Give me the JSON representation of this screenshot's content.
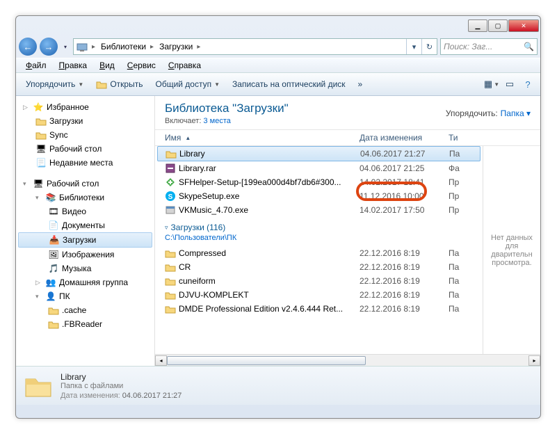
{
  "titlebar": {
    "min": "▁",
    "max": "▢",
    "close": "✕"
  },
  "nav": {
    "back": "←",
    "forward": "→",
    "dd": "▾",
    "refresh": "↻"
  },
  "breadcrumbs": [
    "Библиотеки",
    "Загрузки"
  ],
  "search": {
    "placeholder": "Поиск: Заг...",
    "icon": "🔍"
  },
  "menu": [
    {
      "label": "Файл",
      "u": "Ф"
    },
    {
      "label": "Правка",
      "u": "П"
    },
    {
      "label": "Вид",
      "u": "В"
    },
    {
      "label": "Сервис",
      "u": "С"
    },
    {
      "label": "Справка",
      "u": "С"
    }
  ],
  "toolbar": {
    "organize": "Упорядочить",
    "open": "Открыть",
    "share": "Общий доступ",
    "burn": "Записать на оптический диск",
    "more": "»"
  },
  "sidebar": {
    "favorites": {
      "label": "Избранное",
      "items": [
        {
          "label": "Загрузки",
          "ic": "folder"
        },
        {
          "label": "Sync",
          "ic": "folder"
        },
        {
          "label": "Рабочий стол",
          "ic": "desktop"
        },
        {
          "label": "Недавние места",
          "ic": "recent"
        }
      ]
    },
    "desktop": {
      "label": "Рабочий стол",
      "items": [
        {
          "label": "Библиотеки",
          "ic": "lib",
          "children": [
            {
              "label": "Видео",
              "ic": "video"
            },
            {
              "label": "Документы",
              "ic": "doc"
            },
            {
              "label": "Загрузки",
              "ic": "dl",
              "selected": true
            },
            {
              "label": "Изображения",
              "ic": "img"
            },
            {
              "label": "Музыка",
              "ic": "music"
            }
          ]
        },
        {
          "label": "Домашняя группа",
          "ic": "home"
        },
        {
          "label": "ПК",
          "ic": "pc",
          "children": [
            {
              "label": ".cache",
              "ic": "folder"
            },
            {
              "label": ".FBReader",
              "ic": "folder"
            }
          ]
        }
      ]
    }
  },
  "library": {
    "title": "Библиотека \"Загрузки\"",
    "includes_label": "Включает:",
    "includes_link": "3 места",
    "arrange_label": "Упорядочить:",
    "arrange_value": "Папка"
  },
  "columns": {
    "name": "Имя",
    "date": "Дата изменения",
    "type": "Ти"
  },
  "files_top": [
    {
      "name": "Library",
      "date": "04.06.2017 21:27",
      "type": "Па",
      "ic": "folder",
      "selected": true
    },
    {
      "name": "Library.rar",
      "date": "04.06.2017 21:25",
      "type": "Фа",
      "ic": "rar"
    },
    {
      "name": "SFHelper-Setup-[199ea000d4bf7db6#300...",
      "date": "14.02.2017 18:41",
      "type": "Пр",
      "ic": "exe-g"
    },
    {
      "name": "SkypeSetup.exe",
      "date": "11.12.2016 10:00",
      "type": "Пр",
      "ic": "skype"
    },
    {
      "name": "VKMusic_4.70.exe",
      "date": "14.02.2017 17:50",
      "type": "Пр",
      "ic": "exe"
    }
  ],
  "group": {
    "title": "Загрузки (116)",
    "path": "C:\\Пользователи\\ПК"
  },
  "files_bottom": [
    {
      "name": "Compressed",
      "date": "22.12.2016 8:19",
      "type": "Па",
      "ic": "folder"
    },
    {
      "name": "CR",
      "date": "22.12.2016 8:19",
      "type": "Па",
      "ic": "folder"
    },
    {
      "name": "cuneiform",
      "date": "22.12.2016 8:19",
      "type": "Па",
      "ic": "folder"
    },
    {
      "name": "DJVU-KOMPLEKT",
      "date": "22.12.2016 8:19",
      "type": "Па",
      "ic": "folder"
    },
    {
      "name": "DMDE Professional Edition v2.4.6.444 Ret...",
      "date": "22.12.2016 8:19",
      "type": "Па",
      "ic": "folder"
    }
  ],
  "preview": {
    "empty": "Нет данных для дварительн просмотра."
  },
  "details": {
    "name": "Library",
    "type": "Папка с файлами",
    "mod_label": "Дата изменения:",
    "mod_value": "04.06.2017 21:27"
  }
}
